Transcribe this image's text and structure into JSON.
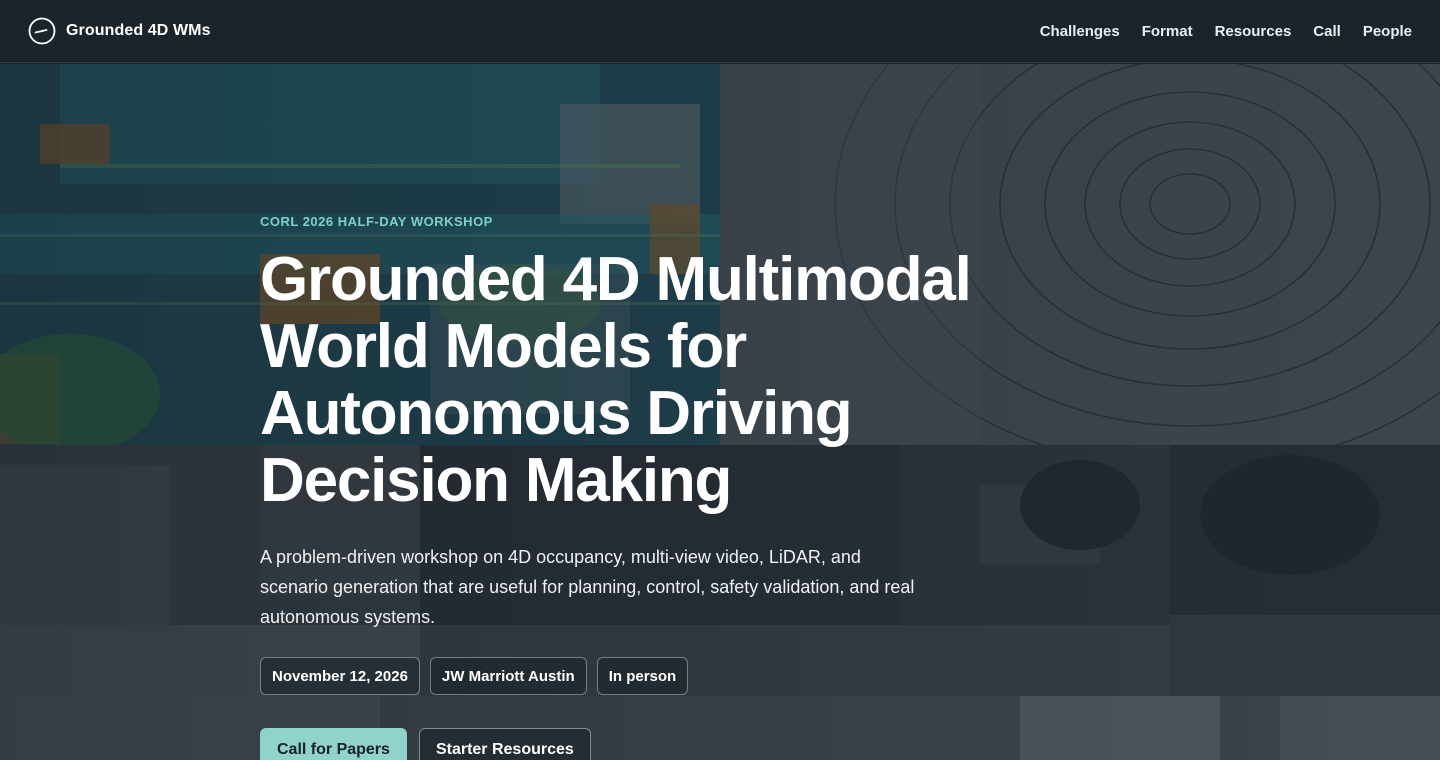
{
  "navbar": {
    "brand_name": "Grounded 4D WMs",
    "brand_icon": "circle-dash-logo-icon",
    "links": [
      {
        "label": "Challenges"
      },
      {
        "label": "Format"
      },
      {
        "label": "Resources"
      },
      {
        "label": "Call"
      },
      {
        "label": "People"
      }
    ]
  },
  "hero": {
    "eyebrow": "CORL 2026 HALF-DAY WORKSHOP",
    "title_lines": [
      "Grounded 4D Multimodal",
      "World Models for",
      "Autonomous Driving",
      "Decision Making"
    ],
    "subtitle_lines": [
      "A problem-driven workshop on 4D occupancy, multi-view video, LiDAR, and",
      "scenario generation that are useful for planning, control, safety validation, and real",
      "autonomous systems."
    ],
    "chips": [
      {
        "label": "November 12, 2026"
      },
      {
        "label": "JW Marriott Austin"
      },
      {
        "label": "In person"
      }
    ],
    "cta_primary": "Call for Papers",
    "cta_secondary": "Starter Resources"
  },
  "colors": {
    "accent": "#8fd3ca",
    "eyebrow": "#7fd1c7",
    "navbar_bg": "#1b242c",
    "page_bg": "#1d2731"
  }
}
